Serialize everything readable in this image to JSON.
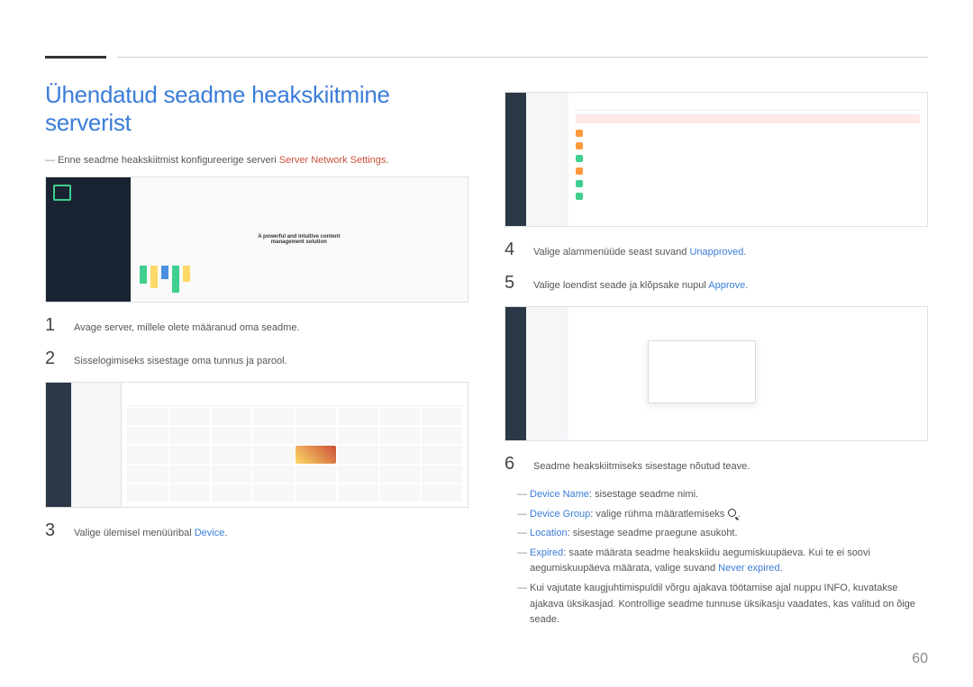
{
  "page_title": "Ühendatud seadme heakskiitmine serverist",
  "intro": {
    "prefix": "Enne seadme heakskiitmist konfigureerige serveri ",
    "link": "Server Network Settings",
    "suffix": "."
  },
  "screenshot1_tagline": "A powerful and intuitive content management solution",
  "steps": {
    "s1": {
      "num": "1",
      "text": "Avage server, millele olete määranud oma seadme."
    },
    "s2": {
      "num": "2",
      "text": "Sisselogimiseks sisestage oma tunnus ja parool."
    },
    "s3": {
      "num": "3",
      "prefix": "Valige ülemisel menüüribal ",
      "link": "Device",
      "suffix": "."
    },
    "s4": {
      "num": "4",
      "prefix": "Valige alammenüüde seast suvand ",
      "link": "Unapproved",
      "suffix": "."
    },
    "s5": {
      "num": "5",
      "prefix": "Valige loendist seade ja klõpsake nupul ",
      "link": "Approve",
      "suffix": "."
    },
    "s6": {
      "num": "6",
      "text": "Seadme heakskiitmiseks sisestage nõutud teave."
    }
  },
  "bullets": {
    "b1": {
      "label": "Device Name",
      "text": ": sisestage seadme nimi."
    },
    "b2": {
      "label": "Device Group",
      "prefix": ": valige rühma määratlemiseks ",
      "suffix": "."
    },
    "b3": {
      "label": "Location",
      "text": ": sisestage seadme praegune asukoht."
    },
    "b4": {
      "label": "Expired",
      "prefix": ": saate määrata seadme heakskiidu aegumiskuupäeva. Kui te ei soovi aegumiskuupäeva määrata, valige suvand ",
      "link": "Never expired",
      "suffix": "."
    },
    "b5": {
      "text": "Kui vajutate kaugjuhtimispuldil võrgu ajakava töötamise ajal nuppu INFO, kuvatakse ajakava üksikasjad. Kontrollige seadme tunnuse üksikasju vaadates, kas valitud on õige seade."
    }
  },
  "page_number": "60"
}
